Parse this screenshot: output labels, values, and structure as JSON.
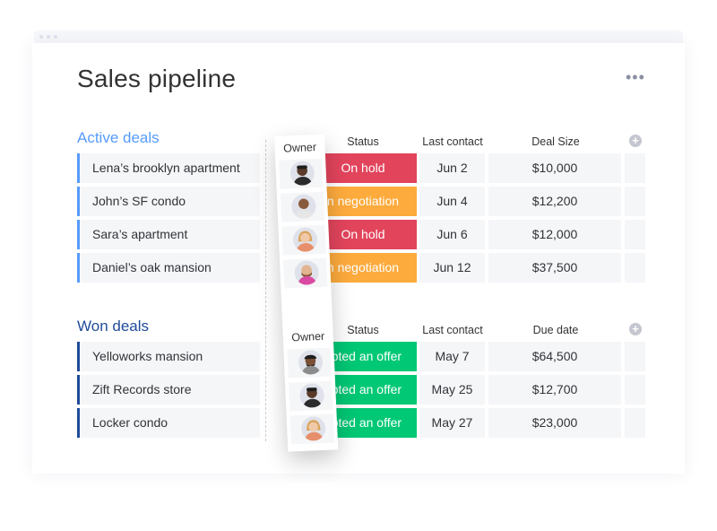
{
  "page_title": "Sales pipeline",
  "more_icon": "•••",
  "add_column_icon": "+",
  "colors": {
    "active_group": "#579bfc",
    "won_group": "#1f4b99",
    "on_hold": "#e2445c",
    "negotiation": "#fdab3d",
    "accepted": "#00c875"
  },
  "active": {
    "title": "Active deals",
    "headers": {
      "owner": "Owner",
      "status": "Status",
      "last_contact": "Last contact",
      "value": "Deal Size"
    },
    "rows": [
      {
        "name": "Lena’s brooklyn apartment",
        "status": "On hold",
        "last_contact": "Jun 2",
        "value": "$10,000"
      },
      {
        "name": "John’s SF condo",
        "status": "n negotiation",
        "last_contact": "Jun 4",
        "value": "$12,200"
      },
      {
        "name": "Sara’s apartment",
        "status": "On hold",
        "last_contact": "Jun 6",
        "value": "$12,000"
      },
      {
        "name": "Daniel’s oak mansion",
        "status": "n negotiation",
        "last_contact": "Jun 12",
        "value": "$37,500"
      }
    ]
  },
  "won": {
    "title": "Won deals",
    "headers": {
      "owner": "Owner",
      "status": "Status",
      "last_contact": "Last contact",
      "value": "Due date"
    },
    "rows": [
      {
        "name": "Yelloworks mansion",
        "status": "epted an offer",
        "last_contact": "May 7",
        "value": "$64,500"
      },
      {
        "name": "Zift Records store",
        "status": "epted an offer",
        "last_contact": "May 25",
        "value": "$12,700"
      },
      {
        "name": "Locker condo",
        "status": "epted an offer",
        "last_contact": "May 27",
        "value": "$23,000"
      }
    ]
  },
  "owner_avatars": [
    "avatar-man-dark",
    "avatar-man-bald",
    "avatar-woman-blonde",
    "avatar-man-beard",
    "avatar-man-cap",
    "avatar-man-dark",
    "avatar-woman-blonde"
  ]
}
